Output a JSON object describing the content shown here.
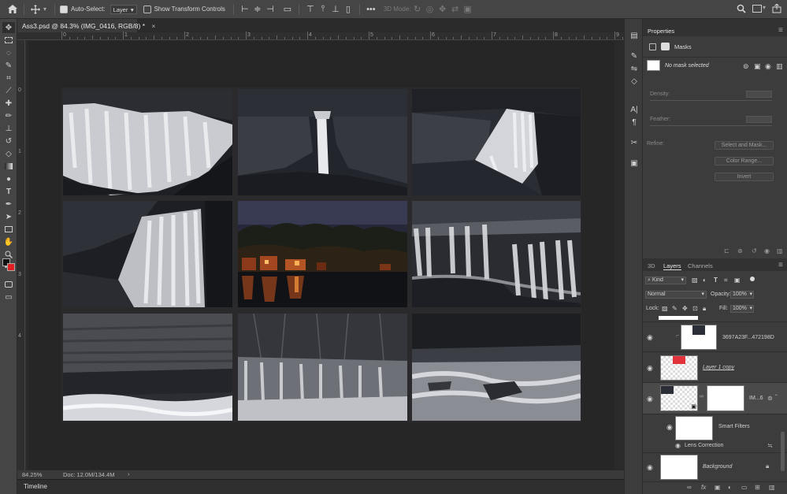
{
  "optionsbar": {
    "auto_select_label": "Auto-Select:",
    "auto_select_value": "Layer",
    "show_transform_label": "Show Transform Controls",
    "mode_3d_label": "3D Mode:"
  },
  "document": {
    "tab_label": "Ass3.psd @ 84.3% (IMG_0416, RGB/8) *",
    "ruler_ticks": [
      "0",
      "1",
      "2",
      "3",
      "4",
      "5",
      "6",
      "7",
      "8",
      "9"
    ],
    "ruler_left_ticks": [
      "0",
      "1",
      "2",
      "3",
      "4"
    ]
  },
  "status": {
    "zoom": "84.25%",
    "doc_size": "Doc: 12.0M/134.4M"
  },
  "timeline_label": "Timeline",
  "properties": {
    "title": "Properties",
    "section": "Masks",
    "no_mask": "No mask selected",
    "density_label": "Density:",
    "feather_label": "Feather:",
    "refine_label": "Refine:",
    "select_and_mask": "Select and Mask...",
    "color_range": "Color Range...",
    "invert": "Invert"
  },
  "layers_panel": {
    "tabs": [
      "3D",
      "Layers",
      "Channels"
    ],
    "kind_filter": "Kind",
    "blend_mode": "Normal",
    "opacity_label": "Opacity:",
    "opacity_value": "100%",
    "lock_label": "Lock:",
    "fill_label": "Fill:",
    "fill_value": "100%",
    "layers": [
      {
        "name": "3697A23F...472198D"
      },
      {
        "name": "Layer 1 copy"
      },
      {
        "name": "IM...6"
      },
      {
        "name": "Smart Filters"
      },
      {
        "name": "Lens Correction"
      },
      {
        "name": "Background"
      }
    ]
  },
  "colors": {
    "foreground": "#111111",
    "background": "#e02020",
    "accent_red": "#e2333d"
  },
  "photos": [
    {
      "id": "waterfall-1"
    },
    {
      "id": "waterfall-2"
    },
    {
      "id": "waterfall-3"
    },
    {
      "id": "waterfall-4"
    },
    {
      "id": "night-cabins"
    },
    {
      "id": "waterfall-6"
    },
    {
      "id": "cliff-river"
    },
    {
      "id": "cascade-forest"
    },
    {
      "id": "river-rocks"
    }
  ]
}
